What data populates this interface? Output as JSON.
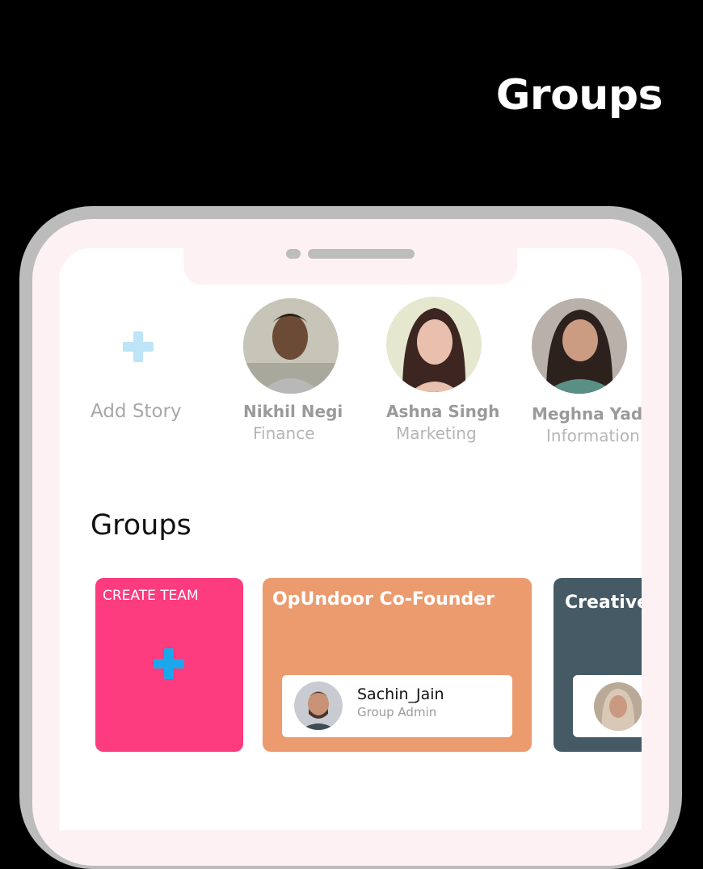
{
  "page": {
    "heading": "Groups"
  },
  "stories": {
    "add_label": "Add Story",
    "people": [
      {
        "name": "Nikhil Negi",
        "dept": "Finance"
      },
      {
        "name": "Ashna Singh",
        "dept": "Marketing"
      },
      {
        "name": "Meghna Yadav",
        "dept": "Information"
      }
    ]
  },
  "groups": {
    "title": "Groups",
    "create_label": "CREATE TEAM",
    "cards": [
      {
        "title": "OpUndoor Co-Founder",
        "admin_name": "Sachin_Jain",
        "admin_role": "Group Admin",
        "color": "#ec9b6f"
      },
      {
        "title": "Creative",
        "color": "#455a64"
      }
    ],
    "create_color": "#fd3b7f"
  },
  "colors": {
    "accent_blue": "#1aa7ec",
    "story_plus": "#bde4f7"
  }
}
